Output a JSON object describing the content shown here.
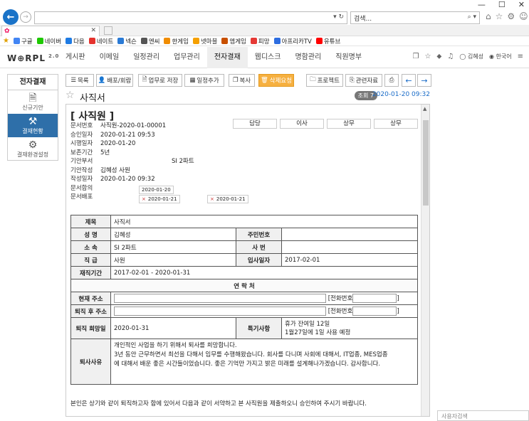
{
  "browser": {
    "window_controls": [
      "—",
      "☐",
      "✕"
    ],
    "search_placeholder": "검색...",
    "bookmarks": [
      {
        "label": "구글",
        "color": "#4285f4"
      },
      {
        "label": "네이버",
        "color": "#1ec800"
      },
      {
        "label": "다음",
        "color": "#1e7be3"
      },
      {
        "label": "네이트",
        "color": "#e5322d"
      },
      {
        "label": "넥슨",
        "color": "#2a7ad5"
      },
      {
        "label": "엔씨",
        "color": "#555555"
      },
      {
        "label": "한게임",
        "color": "#f08c00"
      },
      {
        "label": "넷마블",
        "color": "#f5a000"
      },
      {
        "label": "엠게임",
        "color": "#c85000"
      },
      {
        "label": "피망",
        "color": "#e53935"
      },
      {
        "label": "아프리카TV",
        "color": "#2d6de0"
      },
      {
        "label": "유튜브",
        "color": "#ff0000"
      }
    ]
  },
  "app": {
    "logo": "W⊕RPL",
    "logo_version": "2.0",
    "nav": [
      "게시판",
      "이메일",
      "일정관리",
      "업무관리",
      "전자결재",
      "웹디스크",
      "명함관리",
      "직원명부"
    ],
    "active_nav": "전자결재",
    "user_name": "김혜성",
    "language": "한국어"
  },
  "sidebar": {
    "title": "전자결재",
    "items": [
      {
        "label": "신규기안",
        "icon": "document-icon"
      },
      {
        "label": "결재현황",
        "icon": "gavel-icon"
      },
      {
        "label": "결재환경설정",
        "icon": "gear-icon"
      }
    ]
  },
  "toolbar": {
    "list": "목록",
    "distribute": "배포/회람",
    "save_task": "업무로 저장",
    "add_schedule": "일정추가",
    "copy": "복사",
    "delete_request": "삭제요청",
    "project": "프로젝트",
    "related": "관련자료",
    "print": "",
    "prev": "←",
    "next": "→"
  },
  "doc": {
    "title": "사직서",
    "views": "조회 7",
    "date": "2020-01-20 09:32",
    "heading": "[ 사직원 ]",
    "meta": [
      {
        "k": "문서번호",
        "v": "사직원-2020-01-00001"
      },
      {
        "k": "승인일자",
        "v": "2020-01-21 09:53"
      },
      {
        "k": "시행일자",
        "v": "2020-01-20"
      },
      {
        "k": "보존기간",
        "v": "5년"
      },
      {
        "k": "기안부서",
        "v": "SI 2파트"
      },
      {
        "k": "기안작성",
        "v": "김혜성 사원"
      },
      {
        "k": "작성일자",
        "v": "2020-01-20 09:32"
      },
      {
        "k": "문서합의",
        "v": ""
      },
      {
        "k": "문서배포",
        "v": ""
      }
    ],
    "agree_date": "2020-01-20",
    "distribute_dates": [
      "2020-01-21",
      "2020-01-21"
    ],
    "approvals": [
      "담당",
      "이사",
      "상무",
      "상무"
    ]
  },
  "form": {
    "subject_label": "제목",
    "subject": "사직서",
    "name_label": "성 명",
    "name": "김혜성",
    "rrn_label": "주민번호",
    "rrn": "",
    "dept_label": "소 속",
    "dept": "SI 2파트",
    "empno_label": "사 번",
    "empno": "",
    "rank_label": "직 급",
    "rank": "사원",
    "join_label": "입사일자",
    "join": "2017-02-01",
    "period_label": "재직기간",
    "period": "2017-02-01 - 2020-01-31",
    "contact_label": "연 락 처",
    "cur_addr_label": "현재 주소",
    "phone_label": "[전화번호",
    "after_addr_label": "퇴직 후 주소",
    "leave_label": "퇴직 희망일",
    "leave": "2020-01-31",
    "note_label": "특기사항",
    "note_1": "휴가 잔여일 12일",
    "note_2": "1월27일에 1일 사용 예정",
    "reason_label": "퇴사사유",
    "reason_1": "개인적인 사업을 하기 위해서 퇴사를 희망합니다.",
    "reason_2": "3년 동안 근무하면서 최선을 다해서 임무를 수행해왔습니다. 회사를 다니며 사회에 대해서, IT업종, MES업종",
    "reason_3": "에 대해서 배운 좋은 시간들이었습니다. 좋은 기억만 가지고 밝은 미래를 설계해나가겠습니다. 감사합니다."
  },
  "footer": "본인은 상기와 같이 퇴직하고자 함에 있어서 다음과 같이 서약하고 본 사직원을 제출하오니 승인하여 주시기 바랍니다.",
  "user_search": "사용자검색"
}
